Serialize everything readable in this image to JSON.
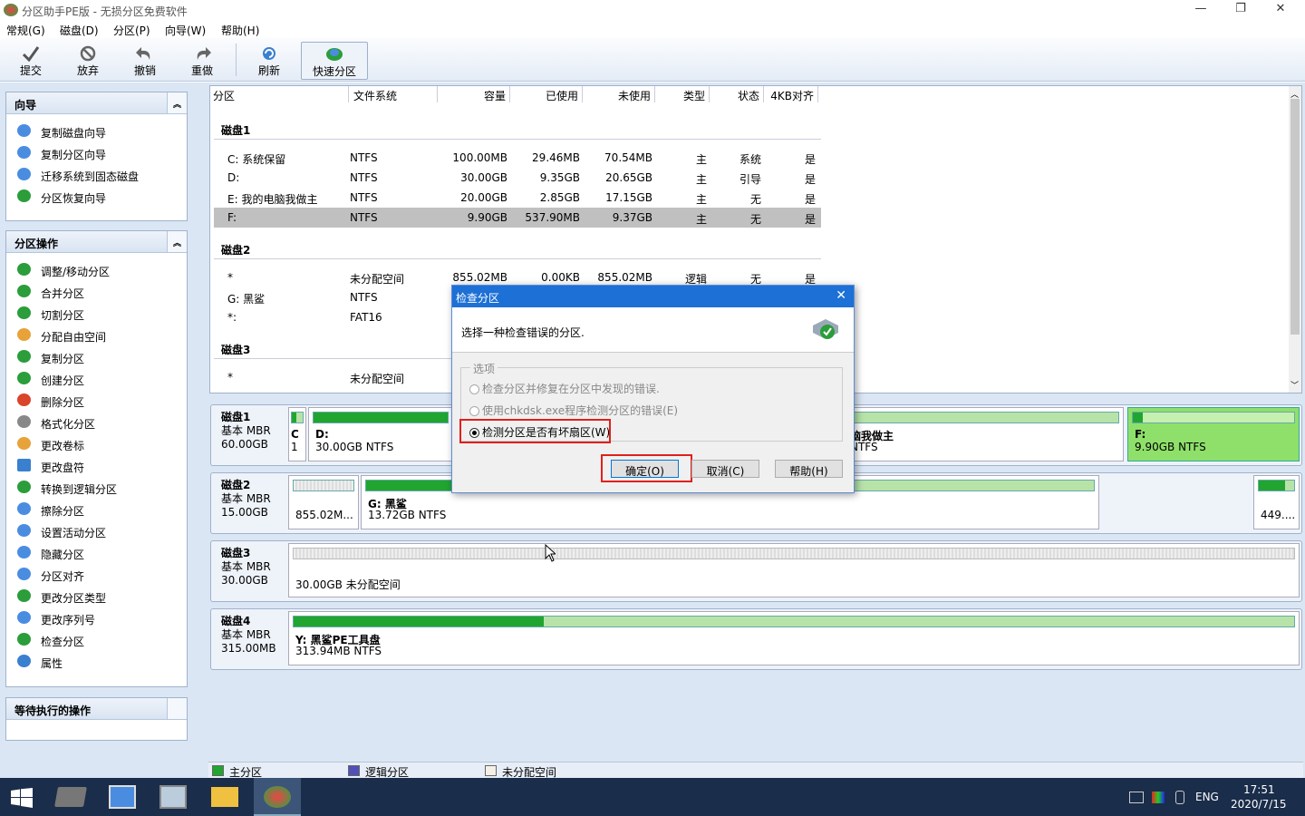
{
  "window": {
    "title": "分区助手PE版 - 无损分区免费软件",
    "controls": [
      "—",
      "❐",
      "✕"
    ]
  },
  "menu": [
    "常规(G)",
    "磁盘(D)",
    "分区(P)",
    "向导(W)",
    "帮助(H)"
  ],
  "toolbar": [
    {
      "label": "提交",
      "icon": "commit-check-icon"
    },
    {
      "label": "放弃",
      "icon": "discard-icon"
    },
    {
      "label": "撤销",
      "icon": "undo-icon"
    },
    {
      "label": "重做",
      "icon": "redo-icon"
    },
    {
      "label": "刷新",
      "icon": "refresh-icon"
    },
    {
      "label": "快速分区",
      "icon": "quick-partition-icon"
    }
  ],
  "wizard_panel": {
    "title": "向导",
    "items": [
      "复制磁盘向导",
      "复制分区向导",
      "迁移系统到固态磁盘",
      "分区恢复向导"
    ]
  },
  "ops_panel": {
    "title": "分区操作",
    "items": [
      "调整/移动分区",
      "合并分区",
      "切割分区",
      "分配自由空间",
      "复制分区",
      "创建分区",
      "删除分区",
      "格式化分区",
      "更改卷标",
      "更改盘符",
      "转换到逻辑分区",
      "擦除分区",
      "设置活动分区",
      "隐藏分区",
      "分区对齐",
      "更改分区类型",
      "更改序列号",
      "检查分区",
      "属性"
    ]
  },
  "pending_panel": {
    "title": "等待执行的操作"
  },
  "table": {
    "columns": [
      "分区",
      "文件系统",
      "容量",
      "已使用",
      "未使用",
      "类型",
      "状态",
      "4KB对齐"
    ],
    "disk1": "磁盘1",
    "disk1_rows": [
      [
        "C: 系统保留",
        "NTFS",
        "100.00MB",
        "29.46MB",
        "70.54MB",
        "主",
        "系统",
        "是"
      ],
      [
        "D:",
        "NTFS",
        "30.00GB",
        "9.35GB",
        "20.65GB",
        "主",
        "引导",
        "是"
      ],
      [
        "E: 我的电脑我做主",
        "NTFS",
        "20.00GB",
        "2.85GB",
        "17.15GB",
        "主",
        "无",
        "是"
      ],
      [
        "F:",
        "NTFS",
        "9.90GB",
        "537.90MB",
        "9.37GB",
        "主",
        "无",
        "是"
      ]
    ],
    "disk2": "磁盘2",
    "disk2_rows": [
      [
        "*",
        "未分配空间",
        "855.02MB",
        "0.00KB",
        "855.02MB",
        "逻辑",
        "无",
        "是"
      ],
      [
        "G: 黑鲨",
        "NTFS",
        "",
        "",
        "",
        "",
        "",
        ""
      ],
      [
        "*:",
        "FAT16",
        "",
        "",
        "",
        "",
        "",
        ""
      ]
    ],
    "disk3": "磁盘3",
    "disk3_rows": [
      [
        "*",
        "未分配空间",
        "",
        "",
        "",
        "",
        "",
        ""
      ]
    ]
  },
  "disk_map": [
    {
      "name": "磁盘1",
      "type": "基本 MBR",
      "size": "60.00GB",
      "parts": [
        {
          "label": "C",
          "info": "1"
        },
        {
          "label": "D:",
          "info": "30.00GB NTFS"
        },
        {
          "label": "脑我做主",
          "info": "NTFS"
        },
        {
          "label": "F:",
          "info": "9.90GB NTFS"
        }
      ]
    },
    {
      "name": "磁盘2",
      "type": "基本 MBR",
      "size": "15.00GB",
      "parts": [
        {
          "label": "",
          "info": "855.02M..."
        },
        {
          "label": "G: 黑鲨",
          "info": "13.72GB NTFS"
        },
        {
          "label": "",
          "info": "449...."
        }
      ]
    },
    {
      "name": "磁盘3",
      "type": "基本 MBR",
      "size": "30.00GB",
      "parts": [
        {
          "label": "",
          "info": "30.00GB 未分配空间"
        }
      ]
    },
    {
      "name": "磁盘4",
      "type": "基本 MBR",
      "size": "315.00MB",
      "parts": [
        {
          "label": "Y: 黑鲨PE工具盘",
          "info": "313.94MB NTFS"
        }
      ]
    }
  ],
  "legend": [
    "主分区",
    "逻辑分区",
    "未分配空间"
  ],
  "dialog": {
    "title": "检查分区",
    "prompt": "选择一种检查错误的分区.",
    "group_label": "选项",
    "options": [
      "检查分区并修复在分区中发现的错误.",
      "使用chkdsk.exe程序检测分区的错误(E)",
      "检测分区是否有坏扇区(W)"
    ],
    "selected_option": 2,
    "ok": "确定(O)",
    "cancel": "取消(C)",
    "help": "帮助(H)"
  },
  "taskbar": {
    "lang": "ENG",
    "time": "17:51",
    "date": "2020/7/15"
  },
  "colors": {
    "primary_partition": "#21a530",
    "accent": "#1c70d6",
    "highlight": "#e0201c"
  }
}
